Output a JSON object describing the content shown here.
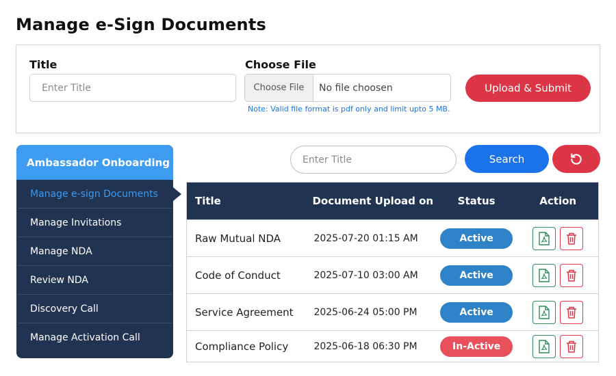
{
  "page": {
    "title": "Manage e-Sign Documents"
  },
  "upload": {
    "title_label": "Title",
    "title_placeholder": "Enter Title",
    "file_label": "Choose File",
    "file_button": "Choose File",
    "file_name": "No file choosen",
    "note": "Note: Valid file format is pdf only and limit upto 5 MB.",
    "submit_label": "Upload & Submit"
  },
  "sidebar": {
    "header": "Ambassador Onboarding",
    "items": [
      {
        "label": "Manage e-sign Documents",
        "active": true
      },
      {
        "label": "Manage Invitations",
        "active": false
      },
      {
        "label": "Manage NDA",
        "active": false
      },
      {
        "label": "Review NDA",
        "active": false
      },
      {
        "label": "Discovery Call",
        "active": false
      },
      {
        "label": "Manage Activation Call",
        "active": false
      }
    ]
  },
  "search": {
    "placeholder": "Enter Title",
    "button_label": "Search",
    "reset_icon": "reset-icon"
  },
  "table": {
    "headers": {
      "title": "Title",
      "date": "Document Upload on",
      "status": "Status",
      "action": "Action"
    },
    "rows": [
      {
        "title": "Raw Mutual NDA",
        "date": "2025-07-20 01:15 AM",
        "status": "Active"
      },
      {
        "title": "Code of Conduct",
        "date": "2025-07-10 03:00 AM",
        "status": "Active"
      },
      {
        "title": "Service Agreement",
        "date": "2025-06-24 05:00 PM",
        "status": "Active"
      },
      {
        "title": "Compliance Policy",
        "date": "2025-06-18 06:30 PM",
        "status": "In-Active"
      }
    ]
  },
  "colors": {
    "navy": "#203452",
    "accent_blue": "#3d9bf0",
    "primary_blue": "#1a73e8",
    "danger_red": "#dc3545",
    "active_badge": "#2d82c8",
    "inactive_badge": "#e8505b",
    "pdf_green": "#2e8b57"
  }
}
